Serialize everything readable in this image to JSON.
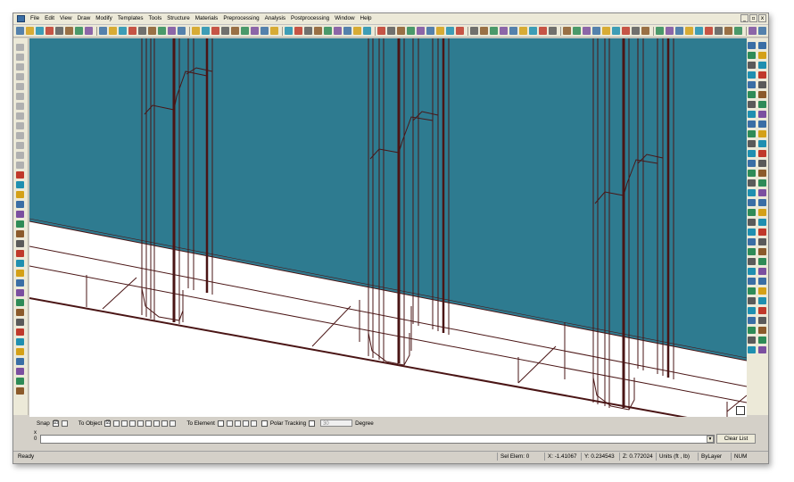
{
  "menu": [
    "File",
    "Edit",
    "View",
    "Draw",
    "Modify",
    "Templates",
    "Tools",
    "Structure",
    "Materials",
    "Preprocessing",
    "Analysis",
    "Postprocessing",
    "Window",
    "Help"
  ],
  "window_controls": [
    "_",
    "▫",
    "x"
  ],
  "snap": {
    "snap_label": "Snap",
    "snap_checked": "☑",
    "to_object_label": "To Object",
    "to_element_label": "To Element",
    "polar_label": "Polar Tracking",
    "degree_value": "30",
    "degree_label": "Degree"
  },
  "command": {
    "close": "x",
    "prompt": "0",
    "clear_label": "Clear List"
  },
  "status": {
    "ready": "Ready",
    "sel_elem": "Sel Elem: 0",
    "x": "X: -1.41067",
    "y": "Y: 0.234543",
    "z": "Z: 0.772024",
    "units": "Units (ft , lb)",
    "layer": "ByLayer",
    "num": "NUM"
  },
  "colors": {
    "viewport_water": "#2e7b90",
    "wire": "#4a1515",
    "chrome": "#d4d0c8"
  }
}
